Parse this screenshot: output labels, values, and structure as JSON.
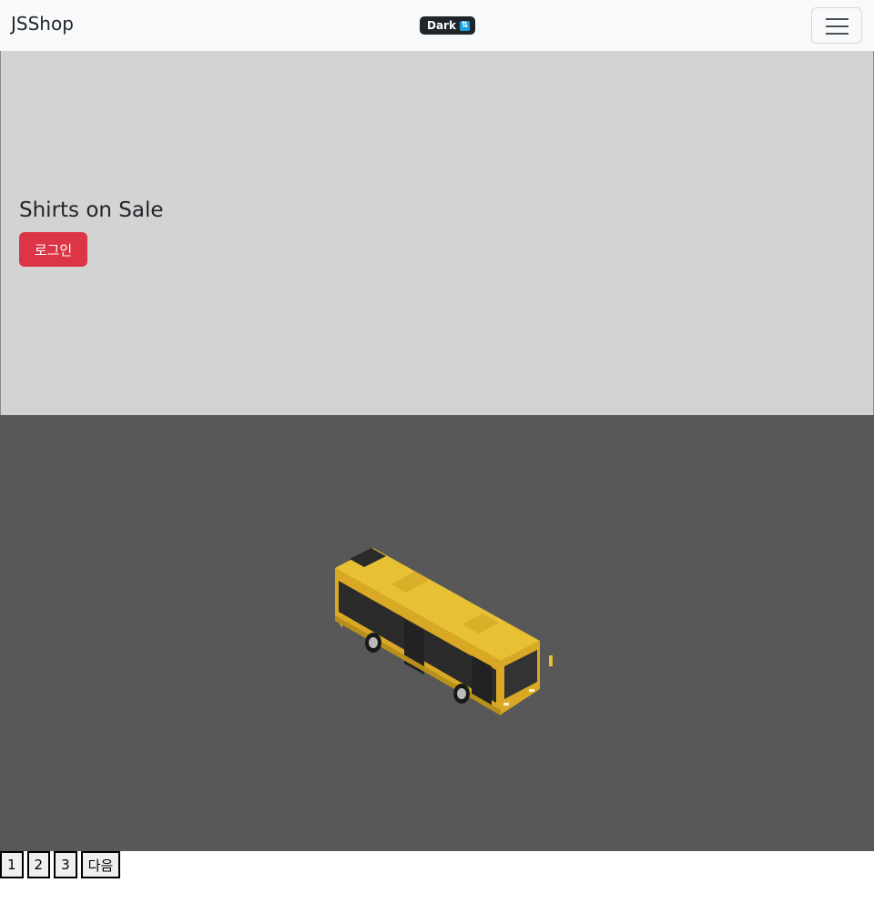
{
  "navbar": {
    "brand": "JSShop",
    "theme_badge": "Dark",
    "theme_icon": "swap-icon",
    "menu_icon": "hamburger-icon"
  },
  "hero": {
    "title": "Shirts on Sale",
    "login_label": "로그인"
  },
  "image_panel": {
    "subject": "yellow city bus",
    "background_color": "#585858"
  },
  "pagination": {
    "pages": [
      "1",
      "2",
      "3"
    ],
    "next_label": "다음"
  },
  "colors": {
    "navbar_bg": "#f8f9fa",
    "hero_bg": "#d3d3d3",
    "login_button": "#dc3545",
    "badge_bg": "#212529"
  }
}
